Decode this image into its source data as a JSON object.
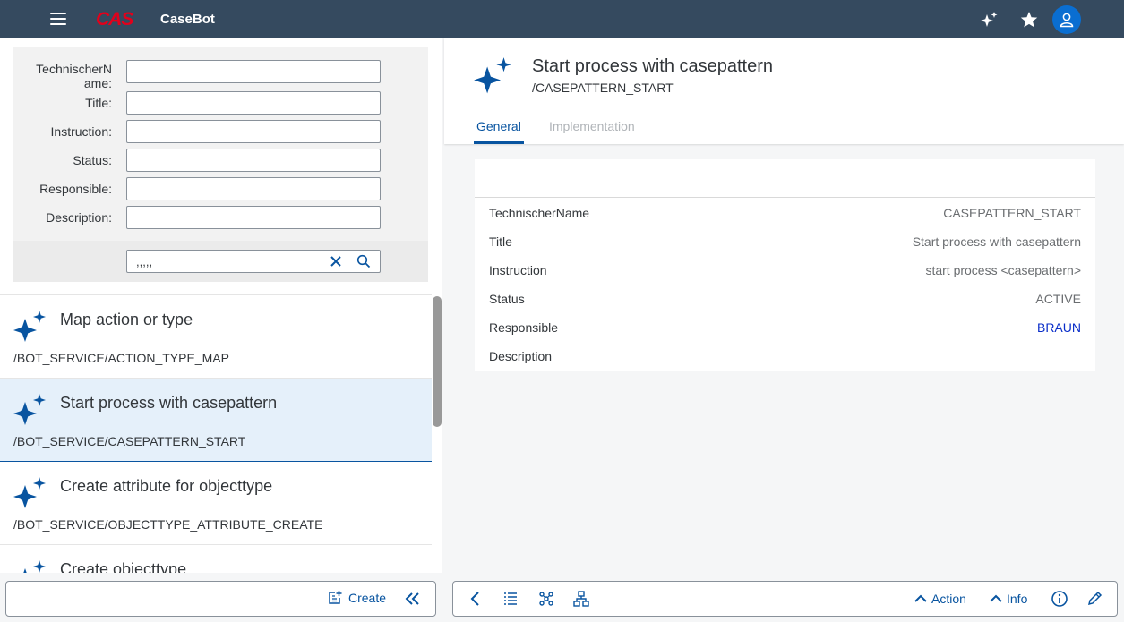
{
  "shell": {
    "logo": "CAS",
    "app_title": "CaseBot"
  },
  "filter": {
    "fields": [
      {
        "label_line1": "TechnischerN",
        "label_line2": "ame:",
        "value": ""
      },
      {
        "label_line1": "Title:",
        "label_line2": "",
        "value": ""
      },
      {
        "label_line1": "Instruction:",
        "label_line2": "",
        "value": ""
      },
      {
        "label_line1": "Status:",
        "label_line2": "",
        "value": ""
      },
      {
        "label_line1": "Responsible:",
        "label_line2": "",
        "value": ""
      },
      {
        "label_line1": "Description:",
        "label_line2": "",
        "value": ""
      }
    ],
    "search_value": ",,,,,"
  },
  "list": {
    "items": [
      {
        "title": "Map action or type",
        "subtitle": "/BOT_SERVICE/ACTION_TYPE_MAP"
      },
      {
        "title": "Start process with casepattern",
        "subtitle": "/BOT_SERVICE/CASEPATTERN_START"
      },
      {
        "title": "Create attribute for objecttype",
        "subtitle": "/BOT_SERVICE/OBJECTTYPE_ATTRIBUTE_CREATE"
      },
      {
        "title": "Create objecttype",
        "subtitle": ""
      }
    ]
  },
  "left_footer": {
    "create_label": "Create"
  },
  "detail": {
    "title": "Start process with casepattern",
    "subtitle": "/CASEPATTERN_START",
    "tabs": [
      {
        "label": "General"
      },
      {
        "label": "Implementation"
      }
    ],
    "rows": [
      {
        "label": "TechnischerName",
        "value": "CASEPATTERN_START"
      },
      {
        "label": "Title",
        "value": "Start process with casepattern"
      },
      {
        "label": "Instruction",
        "value": "start process <casepattern>"
      },
      {
        "label": "Status",
        "value": "ACTIVE"
      },
      {
        "label": "Responsible",
        "value": "BRAUN"
      },
      {
        "label": "Description",
        "value": ""
      }
    ]
  },
  "right_footer": {
    "action_label": "Action",
    "info_label": "Info"
  },
  "colors": {
    "shell_bg": "#354a5f",
    "brand_red": "#e3001b",
    "accent_blue": "#0854a0",
    "link_blue": "#0a2ec9",
    "selected_bg": "#e5f0fa"
  }
}
